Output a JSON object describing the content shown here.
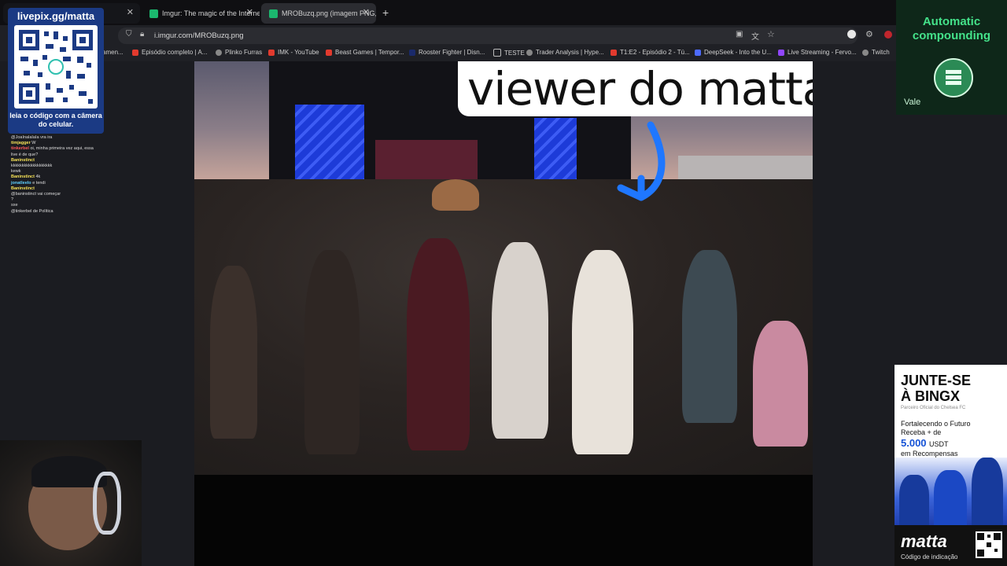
{
  "tabs": [
    {
      "label": "",
      "color": "#f1c01a"
    },
    {
      "label": "Imgur: The magic of the Interne",
      "color": "#1bb76e"
    },
    {
      "label": "MROBuzq.png (imagem PNG, 1",
      "color": "#1bb76e"
    }
  ],
  "url": "i.imgur.com/MROBuzq.png",
  "bookmarks": [
    "amen...",
    "Episódio completo | A...",
    "Plinko Furras",
    "IMK - YouTube",
    "Beast Games | Tempor...",
    "Rooster Fighter | Disn...",
    "TESTE",
    "Trader Analysis | Hype...",
    "T1:E2 - Episódio 2 - Tú...",
    "DeepSeek - Into the U...",
    "Live Streaming - Fervo...",
    "Twitch"
  ],
  "caption": "viewer do matta",
  "qr": {
    "title": "livepix.gg/matta",
    "caption": "leia o código com a câmera do celular."
  },
  "chat": [
    {
      "name": "",
      "text": "@JoaInalaIaIa vra ira"
    },
    {
      "name": "timjagger",
      "text": "W"
    },
    {
      "name": "tinkerbel",
      "text": "oi, minha primeira vez aqui, essa live é de que?"
    },
    {
      "name": "Baninstinct",
      "text": ""
    },
    {
      "name": "",
      "text": "kkkkkkkkkkkkkkkkkkk"
    },
    {
      "name": "",
      "text": "kewk"
    },
    {
      "name": "Baninstinct",
      "text": "4k"
    },
    {
      "name": "jonatleelo",
      "text": "e tendi"
    },
    {
      "name": "Baninstinct",
      "text": ""
    },
    {
      "name": "",
      "text": "@baninstinct vai começar"
    },
    {
      "name": "",
      "text": "?"
    },
    {
      "name": "",
      "text": "sxe"
    },
    {
      "name": "",
      "text": "@tinkerbel de Política"
    }
  ],
  "promo_top": {
    "title_line1": "Automatic",
    "title_line2": "compounding",
    "brand": "Vale"
  },
  "bingx": {
    "headline1": "JUNTE-SE",
    "headline2": "À BINGX",
    "sub": "Parceiro Oficial do Chelsea FC",
    "line1": "Fortalecendo o Futuro",
    "line2": "Receba + de",
    "amount": "5.000",
    "unit": "USDT",
    "line3": "em Recompensas",
    "footer_brand": "matta",
    "footer_code": "Código de indicação"
  }
}
